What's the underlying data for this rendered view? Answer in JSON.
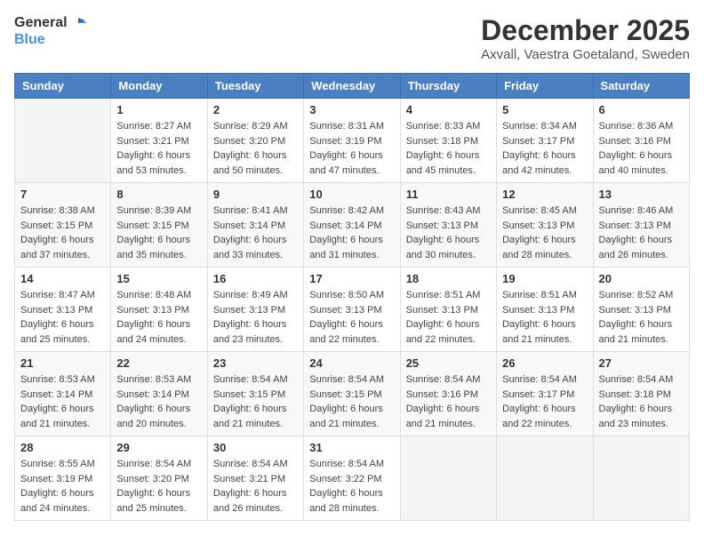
{
  "logo": {
    "line1": "General",
    "line2": "Blue"
  },
  "title": "December 2025",
  "location": "Axvall, Vaestra Goetaland, Sweden",
  "weekdays": [
    "Sunday",
    "Monday",
    "Tuesday",
    "Wednesday",
    "Thursday",
    "Friday",
    "Saturday"
  ],
  "weeks": [
    [
      {
        "day": "",
        "info": ""
      },
      {
        "day": "1",
        "info": "Sunrise: 8:27 AM\nSunset: 3:21 PM\nDaylight: 6 hours\nand 53 minutes."
      },
      {
        "day": "2",
        "info": "Sunrise: 8:29 AM\nSunset: 3:20 PM\nDaylight: 6 hours\nand 50 minutes."
      },
      {
        "day": "3",
        "info": "Sunrise: 8:31 AM\nSunset: 3:19 PM\nDaylight: 6 hours\nand 47 minutes."
      },
      {
        "day": "4",
        "info": "Sunrise: 8:33 AM\nSunset: 3:18 PM\nDaylight: 6 hours\nand 45 minutes."
      },
      {
        "day": "5",
        "info": "Sunrise: 8:34 AM\nSunset: 3:17 PM\nDaylight: 6 hours\nand 42 minutes."
      },
      {
        "day": "6",
        "info": "Sunrise: 8:36 AM\nSunset: 3:16 PM\nDaylight: 6 hours\nand 40 minutes."
      }
    ],
    [
      {
        "day": "7",
        "info": "Sunrise: 8:38 AM\nSunset: 3:15 PM\nDaylight: 6 hours\nand 37 minutes."
      },
      {
        "day": "8",
        "info": "Sunrise: 8:39 AM\nSunset: 3:15 PM\nDaylight: 6 hours\nand 35 minutes."
      },
      {
        "day": "9",
        "info": "Sunrise: 8:41 AM\nSunset: 3:14 PM\nDaylight: 6 hours\nand 33 minutes."
      },
      {
        "day": "10",
        "info": "Sunrise: 8:42 AM\nSunset: 3:14 PM\nDaylight: 6 hours\nand 31 minutes."
      },
      {
        "day": "11",
        "info": "Sunrise: 8:43 AM\nSunset: 3:13 PM\nDaylight: 6 hours\nand 30 minutes."
      },
      {
        "day": "12",
        "info": "Sunrise: 8:45 AM\nSunset: 3:13 PM\nDaylight: 6 hours\nand 28 minutes."
      },
      {
        "day": "13",
        "info": "Sunrise: 8:46 AM\nSunset: 3:13 PM\nDaylight: 6 hours\nand 26 minutes."
      }
    ],
    [
      {
        "day": "14",
        "info": "Sunrise: 8:47 AM\nSunset: 3:13 PM\nDaylight: 6 hours\nand 25 minutes."
      },
      {
        "day": "15",
        "info": "Sunrise: 8:48 AM\nSunset: 3:13 PM\nDaylight: 6 hours\nand 24 minutes."
      },
      {
        "day": "16",
        "info": "Sunrise: 8:49 AM\nSunset: 3:13 PM\nDaylight: 6 hours\nand 23 minutes."
      },
      {
        "day": "17",
        "info": "Sunrise: 8:50 AM\nSunset: 3:13 PM\nDaylight: 6 hours\nand 22 minutes."
      },
      {
        "day": "18",
        "info": "Sunrise: 8:51 AM\nSunset: 3:13 PM\nDaylight: 6 hours\nand 22 minutes."
      },
      {
        "day": "19",
        "info": "Sunrise: 8:51 AM\nSunset: 3:13 PM\nDaylight: 6 hours\nand 21 minutes."
      },
      {
        "day": "20",
        "info": "Sunrise: 8:52 AM\nSunset: 3:13 PM\nDaylight: 6 hours\nand 21 minutes."
      }
    ],
    [
      {
        "day": "21",
        "info": "Sunrise: 8:53 AM\nSunset: 3:14 PM\nDaylight: 6 hours\nand 21 minutes."
      },
      {
        "day": "22",
        "info": "Sunrise: 8:53 AM\nSunset: 3:14 PM\nDaylight: 6 hours\nand 20 minutes."
      },
      {
        "day": "23",
        "info": "Sunrise: 8:54 AM\nSunset: 3:15 PM\nDaylight: 6 hours\nand 21 minutes."
      },
      {
        "day": "24",
        "info": "Sunrise: 8:54 AM\nSunset: 3:15 PM\nDaylight: 6 hours\nand 21 minutes."
      },
      {
        "day": "25",
        "info": "Sunrise: 8:54 AM\nSunset: 3:16 PM\nDaylight: 6 hours\nand 21 minutes."
      },
      {
        "day": "26",
        "info": "Sunrise: 8:54 AM\nSunset: 3:17 PM\nDaylight: 6 hours\nand 22 minutes."
      },
      {
        "day": "27",
        "info": "Sunrise: 8:54 AM\nSunset: 3:18 PM\nDaylight: 6 hours\nand 23 minutes."
      }
    ],
    [
      {
        "day": "28",
        "info": "Sunrise: 8:55 AM\nSunset: 3:19 PM\nDaylight: 6 hours\nand 24 minutes."
      },
      {
        "day": "29",
        "info": "Sunrise: 8:54 AM\nSunset: 3:20 PM\nDaylight: 6 hours\nand 25 minutes."
      },
      {
        "day": "30",
        "info": "Sunrise: 8:54 AM\nSunset: 3:21 PM\nDaylight: 6 hours\nand 26 minutes."
      },
      {
        "day": "31",
        "info": "Sunrise: 8:54 AM\nSunset: 3:22 PM\nDaylight: 6 hours\nand 28 minutes."
      },
      {
        "day": "",
        "info": ""
      },
      {
        "day": "",
        "info": ""
      },
      {
        "day": "",
        "info": ""
      }
    ]
  ]
}
